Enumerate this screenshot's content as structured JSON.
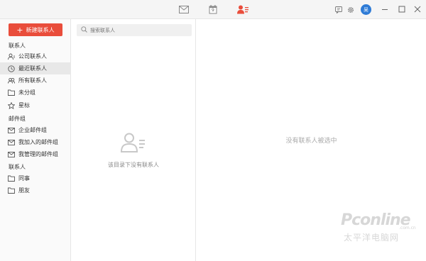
{
  "toolbar": {
    "icons": [
      "mail-icon",
      "calendar-icon",
      "contacts-icon",
      "chat-icon",
      "settings-icon"
    ],
    "calendar_day": "9",
    "avatar_text": "吴",
    "active_color": "#e94d3b"
  },
  "sidebar": {
    "new_button": "新建联系人",
    "section_contacts": "联系人",
    "items_top": [
      {
        "label": "公司联系人",
        "icon": "company-contacts-icon"
      },
      {
        "label": "最近联系人",
        "icon": "clock-icon"
      },
      {
        "label": "所有联系人",
        "icon": "all-contacts-icon"
      },
      {
        "label": "未分组",
        "icon": "folder-icon"
      },
      {
        "label": "星标",
        "icon": "star-icon"
      }
    ],
    "section_mailgroups": "邮件组",
    "items_mail": [
      {
        "label": "企业邮件组",
        "icon": "mail-group-icon"
      },
      {
        "label": "我加入的邮件组",
        "icon": "mail-group-icon"
      },
      {
        "label": "我管理的邮件组",
        "icon": "mail-group-icon"
      }
    ],
    "section_contacts2": "联系人",
    "items_groups": [
      {
        "label": "同事",
        "icon": "folder-icon"
      },
      {
        "label": "朋友",
        "icon": "folder-icon"
      }
    ]
  },
  "list": {
    "search_placeholder": "搜索联系人",
    "empty_text": "该目录下没有联系人"
  },
  "detail": {
    "empty_text": "没有联系人被选中"
  },
  "watermark": {
    "brand": "Pconline",
    "domain": ".com.cn",
    "tagline": "太平洋电脑网"
  }
}
